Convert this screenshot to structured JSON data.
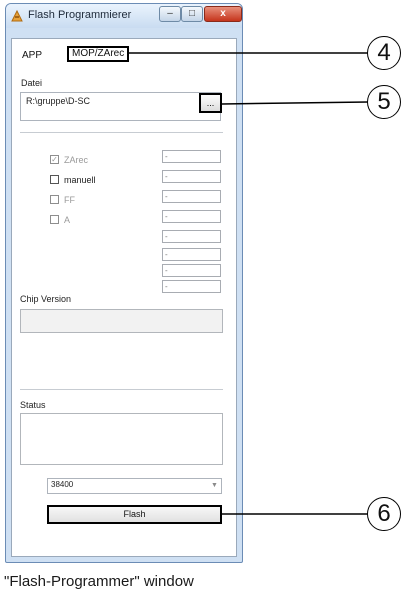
{
  "window": {
    "title": "Flash Programmierer",
    "close_glyph": "x",
    "minimize_glyph": "–",
    "maximize_glyph": "□"
  },
  "tabs": [
    {
      "label": "APP"
    },
    {
      "label": "MOP/ZArec"
    }
  ],
  "file": {
    "label": "Datei",
    "value": "R:\\gruppe\\D-SC",
    "browse_label": "..."
  },
  "options": [
    {
      "label": "ZArec",
      "checked": true,
      "enabled": false
    },
    {
      "label": "manuell",
      "checked": false,
      "enabled": true
    },
    {
      "label": "FF",
      "checked": false,
      "enabled": false
    },
    {
      "label": "A",
      "checked": false,
      "enabled": false
    }
  ],
  "fields": [
    "-",
    "-",
    "-",
    "-",
    "-",
    "-",
    "-",
    "-"
  ],
  "chip_version": {
    "label": "Chip Version",
    "value": ""
  },
  "status": {
    "label": "Status",
    "value": ""
  },
  "baudrate": {
    "value": "38400"
  },
  "flash_button": {
    "label": "Flash"
  },
  "callouts": [
    "4",
    "5",
    "6"
  ],
  "caption": "\"Flash-Programmer\" window",
  "colors": {
    "window_frame": "#cfe0f3",
    "close_button": "#c5341c"
  }
}
